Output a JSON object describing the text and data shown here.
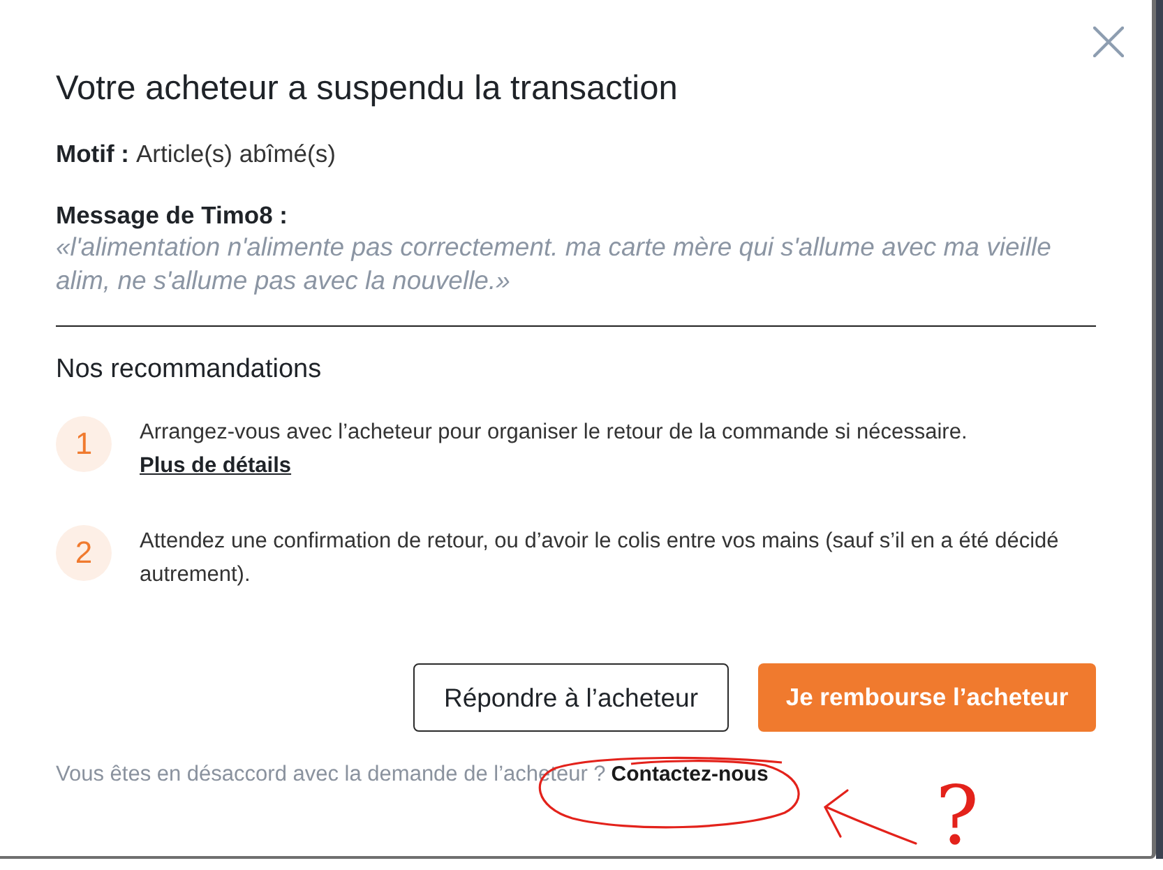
{
  "dialog": {
    "title": "Votre acheteur a suspendu la transaction"
  },
  "reason": {
    "label": "Motif :",
    "value": "Article(s) abîmé(s)"
  },
  "message": {
    "label": "Message de Timo8 :",
    "text": "«l'alimentation n'alimente pas correctement. ma carte mère qui s'allume avec ma vieille alim, ne s'allume pas avec la nouvelle.»"
  },
  "recommendations": {
    "heading": "Nos recommandations",
    "steps": [
      {
        "number": "1",
        "text": "Arrangez-vous avec l’acheteur pour organiser le retour de la commande si nécessaire.",
        "link": "Plus de détails"
      },
      {
        "number": "2",
        "text": "Attendez une confirmation de retour, ou d’avoir le colis entre vos mains (sauf s’il en a été décidé autrement)."
      }
    ]
  },
  "buttons": [
    {
      "label": "Répondre à l’acheteur",
      "kind": "secondary"
    },
    {
      "label": "Je rembourse l’acheteur",
      "kind": "primary"
    }
  ],
  "footer": {
    "text": "Vous êtes en désaccord avec la demande de l’acheteur ?",
    "link": "Contactez-nous"
  },
  "annotation": {
    "mark": "?"
  }
}
